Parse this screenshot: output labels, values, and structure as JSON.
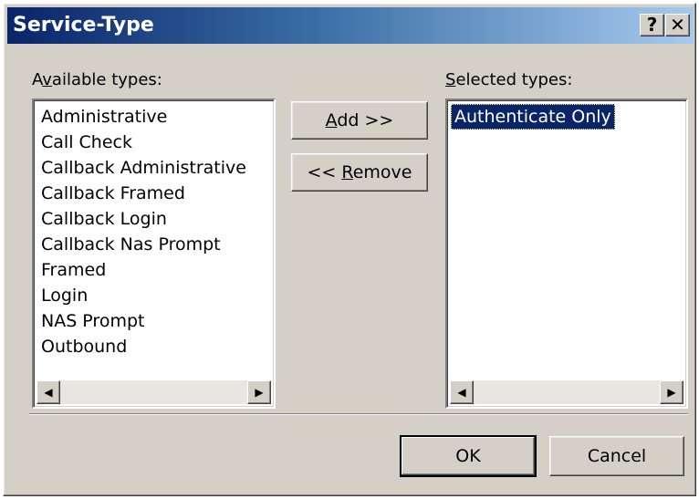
{
  "window": {
    "title": "Service-Type",
    "help_label": "?",
    "close_label": "✕"
  },
  "available": {
    "label_pre": "A",
    "label_key": "v",
    "label_post": "ailable types:",
    "items": [
      "Administrative",
      "Call Check",
      "Callback Administrative",
      "Callback Framed",
      "Callback Login",
      "Callback Nas Prompt",
      "Framed",
      "Login",
      "NAS Prompt",
      "Outbound"
    ]
  },
  "selected": {
    "label_key": "S",
    "label_post": "elected types:",
    "items": [
      "Authenticate Only"
    ]
  },
  "buttons": {
    "add_key": "A",
    "add_rest": "dd >>",
    "remove_pre": "<< ",
    "remove_key": "R",
    "remove_rest": "emove",
    "ok": "OK",
    "cancel": "Cancel"
  },
  "icons": {
    "scroll_left": "◀",
    "scroll_right": "▶"
  }
}
